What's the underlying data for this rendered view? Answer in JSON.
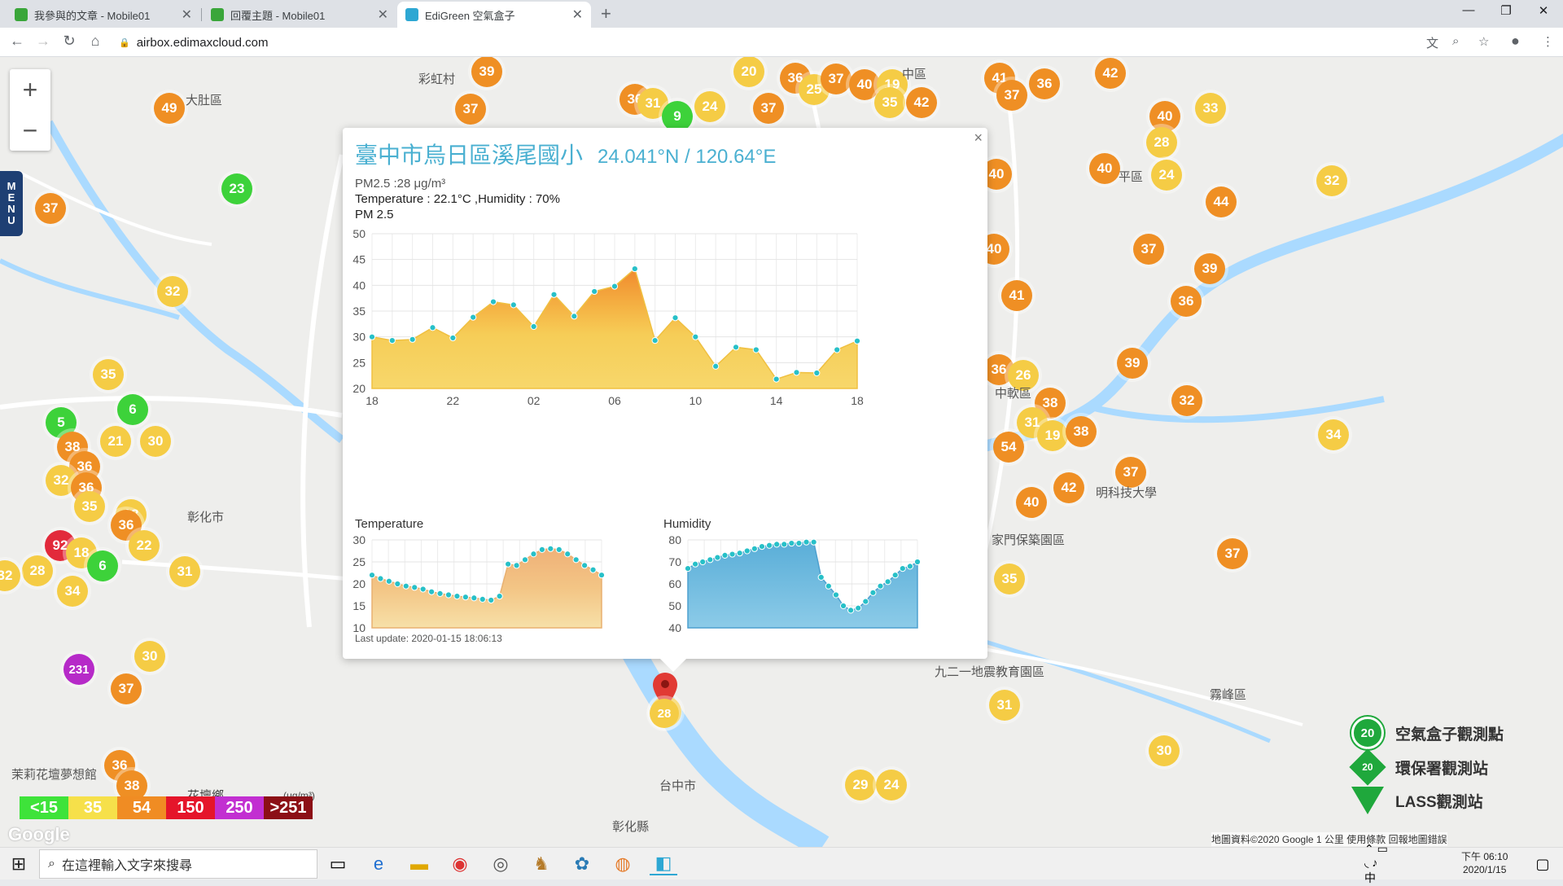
{
  "browser": {
    "tabs": [
      {
        "title": "我參與的文章 - Mobile01",
        "color": "#3aa63a"
      },
      {
        "title": "回覆主題 - Mobile01",
        "color": "#3aa63a"
      },
      {
        "title": "EdiGreen 空氣盒子",
        "color": "#2da7d3"
      }
    ],
    "url": "airbox.edimaxcloud.com"
  },
  "map": {
    "markers": [
      {
        "v": "49",
        "c": "o"
      },
      {
        "v": "39",
        "c": "o"
      },
      {
        "v": "37",
        "c": "o"
      },
      {
        "v": "36",
        "c": "o"
      },
      {
        "v": "31",
        "c": "y"
      },
      {
        "v": "9",
        "c": "g"
      },
      {
        "v": "24",
        "c": "y"
      },
      {
        "v": "37",
        "c": "o"
      },
      {
        "v": "20",
        "c": "y"
      },
      {
        "v": "36",
        "c": "o"
      },
      {
        "v": "25",
        "c": "y"
      },
      {
        "v": "37",
        "c": "o"
      },
      {
        "v": "40",
        "c": "o"
      },
      {
        "v": "19",
        "c": "y"
      },
      {
        "v": "35",
        "c": "y"
      },
      {
        "v": "42",
        "c": "o"
      },
      {
        "v": "41",
        "c": "o"
      },
      {
        "v": "37",
        "c": "o"
      },
      {
        "v": "36",
        "c": "o"
      },
      {
        "v": "42",
        "c": "o"
      },
      {
        "v": "40",
        "c": "o"
      },
      {
        "v": "33",
        "c": "y"
      },
      {
        "v": "28",
        "c": "y"
      },
      {
        "v": "40",
        "c": "o"
      },
      {
        "v": "24",
        "c": "y"
      },
      {
        "v": "32",
        "c": "y"
      },
      {
        "v": "44",
        "c": "o"
      },
      {
        "v": "40",
        "c": "o"
      },
      {
        "v": "37",
        "c": "o"
      },
      {
        "v": "39",
        "c": "o"
      },
      {
        "v": "36",
        "c": "o"
      },
      {
        "v": "41",
        "c": "o"
      },
      {
        "v": "40",
        "c": "o"
      },
      {
        "v": "36",
        "c": "o"
      },
      {
        "v": "26",
        "c": "y"
      },
      {
        "v": "39",
        "c": "o"
      },
      {
        "v": "32",
        "c": "o"
      },
      {
        "v": "38",
        "c": "o"
      },
      {
        "v": "31",
        "c": "y"
      },
      {
        "v": "19",
        "c": "y"
      },
      {
        "v": "38",
        "c": "o"
      },
      {
        "v": "34",
        "c": "y"
      },
      {
        "v": "54",
        "c": "o"
      },
      {
        "v": "37",
        "c": "o"
      },
      {
        "v": "42",
        "c": "o"
      },
      {
        "v": "40",
        "c": "o"
      },
      {
        "v": "37",
        "c": "o"
      },
      {
        "v": "35",
        "c": "y"
      },
      {
        "v": "31",
        "c": "y"
      },
      {
        "v": "30",
        "c": "y"
      },
      {
        "v": "29",
        "c": "y"
      },
      {
        "v": "24",
        "c": "y"
      },
      {
        "v": "28",
        "c": "y"
      },
      {
        "v": "23",
        "c": "g"
      },
      {
        "v": "32",
        "c": "y"
      },
      {
        "v": "35",
        "c": "y"
      },
      {
        "v": "6",
        "c": "g"
      },
      {
        "v": "5",
        "c": "g"
      },
      {
        "v": "38",
        "c": "o"
      },
      {
        "v": "21",
        "c": "y"
      },
      {
        "v": "30",
        "c": "y"
      },
      {
        "v": "36",
        "c": "o"
      },
      {
        "v": "32",
        "c": "y"
      },
      {
        "v": "36",
        "c": "o"
      },
      {
        "v": "35",
        "c": "y"
      },
      {
        "v": "18",
        "c": "y"
      },
      {
        "v": "36",
        "c": "o"
      },
      {
        "v": "22",
        "c": "y"
      },
      {
        "v": "92",
        "c": "r"
      },
      {
        "v": "18",
        "c": "y"
      },
      {
        "v": "6",
        "c": "g"
      },
      {
        "v": "28",
        "c": "y"
      },
      {
        "v": "34",
        "c": "y"
      },
      {
        "v": "31",
        "c": "y"
      },
      {
        "v": "231",
        "c": "p"
      },
      {
        "v": "30",
        "c": "y"
      },
      {
        "v": "37",
        "c": "o"
      },
      {
        "v": "36",
        "c": "o"
      },
      {
        "v": "38",
        "c": "o"
      },
      {
        "v": "32",
        "c": "y"
      },
      {
        "v": "37",
        "c": "o"
      }
    ],
    "labels": [
      "大肚區",
      "彩虹村",
      "中區",
      "平區",
      "彰化市",
      "中軟區",
      "明科技大學",
      "家門保築園區",
      "九二一地震教育園區",
      "霧峰區",
      "茉莉花壇夢想館",
      "花壇鄉",
      "台中市",
      "彰化縣"
    ],
    "zoom_in": "+",
    "zoom_out": "−",
    "menu": "MENU",
    "legend": {
      "unit": "(μg/m³)",
      "items": [
        {
          "label": "<15",
          "color": "#3ee33a"
        },
        {
          "label": "35",
          "color": "#f6e04a"
        },
        {
          "label": "54",
          "color": "#f08c23"
        },
        {
          "label": "150",
          "color": "#e5152a"
        },
        {
          "label": "250",
          "color": "#c22fd1"
        },
        {
          "label": ">251",
          "color": "#8c0f16"
        }
      ]
    },
    "key": [
      {
        "label": "空氣盒子觀測點",
        "value": "20"
      },
      {
        "label": "環保署觀測站",
        "value": "20"
      },
      {
        "label": "LASS觀測站",
        "value": "20"
      }
    ],
    "attribution": "地圖資料©2020 Google   1 公里            使用條款   回報地圖錯誤",
    "google": "Google"
  },
  "popup": {
    "title": "臺中市烏日區溪尾國小",
    "coords": "24.041°N / 120.64°E",
    "pm_line": "PM2.5 :28 μg/m³",
    "th_line": "Temperature : 22.1°C ,Humidity : 70%",
    "pm_title": "PM 2.5",
    "temp_title": "Temperature",
    "hum_title": "Humidity",
    "last_update": "Last update: 2020-01-15 18:06:13",
    "close": "×",
    "pin_value": "28"
  },
  "chart_data": [
    {
      "type": "area",
      "title": "PM 2.5",
      "xticks": [
        "18",
        "22",
        "02",
        "06",
        "10",
        "14",
        "18"
      ],
      "ylim": [
        20,
        50
      ],
      "yticks": [
        20,
        25,
        30,
        35,
        40,
        45,
        50
      ],
      "values": [
        30,
        29.3,
        29.5,
        31.8,
        29.8,
        33.8,
        36.8,
        36.2,
        32,
        38.2,
        34,
        38.8,
        39.8,
        43.2,
        29.3,
        33.7,
        30,
        24.3,
        28,
        27.5,
        21.8,
        23.1,
        23,
        27.5,
        29.2
      ],
      "grid": true
    },
    {
      "type": "area",
      "title": "Temperature",
      "ylim": [
        10,
        30
      ],
      "yticks": [
        10,
        15,
        20,
        25,
        30
      ],
      "values": [
        22,
        21.2,
        20.6,
        20,
        19.5,
        19.2,
        18.8,
        18.2,
        17.8,
        17.5,
        17.2,
        17,
        16.8,
        16.5,
        16.3,
        17.2,
        24.5,
        24.2,
        25.5,
        26.8,
        27.8,
        28,
        27.8,
        26.8,
        25.5,
        24.2,
        23.2,
        22
      ],
      "grid": true
    },
    {
      "type": "area",
      "title": "Humidity",
      "ylim": [
        40,
        80
      ],
      "yticks": [
        40,
        50,
        60,
        70,
        80
      ],
      "values": [
        67,
        69,
        70,
        71,
        72,
        73,
        73.5,
        74,
        75,
        76,
        77,
        77.5,
        78,
        78,
        78.5,
        78.5,
        79,
        79,
        63,
        59,
        55,
        50,
        48,
        49,
        52,
        56,
        59,
        61,
        64,
        67,
        68,
        70
      ],
      "grid": true
    }
  ],
  "taskbar": {
    "search_placeholder": "在這裡輸入文字來搜尋",
    "time": "下午 06:10",
    "date": "2020/1/15"
  }
}
